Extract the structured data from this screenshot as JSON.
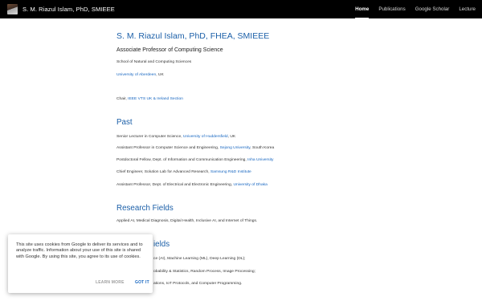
{
  "header": {
    "site_title": "S. M. Riazul Islam, PhD, SMIEEE",
    "nav": [
      {
        "label": "Home"
      },
      {
        "label": "Publications"
      },
      {
        "label": "Google Scholar"
      },
      {
        "label": "Lecture"
      }
    ]
  },
  "profile": {
    "name": "S. M. Riazul Islam, PhD, FHEA, SMIEEE",
    "role": "Associate Professor of Computing Science",
    "school": "School of Natural and Computing Sciences",
    "university_link": "University of Aberdeen",
    "university_suffix": ", UK",
    "chair_prefix": "Chair, ",
    "chair_link": "IEEE VTS UK & Ireland Section"
  },
  "past": {
    "heading": "Past",
    "items": [
      {
        "text": "Senior Lecturer in Computer Science, ",
        "link": "University of Huddersfield",
        "suffix": ", UK"
      },
      {
        "text": "Assistant Professor in Computer Science and Engineering, ",
        "link": "Sejong University",
        "suffix": ", South Korea"
      },
      {
        "text": "Postdoctoral Fellow, Dept. of Information and Communication Engineering, ",
        "link": "Inha University",
        "suffix": ""
      },
      {
        "text": "Chief Engineer, Solution Lab for Advanced Research, ",
        "link": "Samsung R&D Institute",
        "suffix": ""
      },
      {
        "text": "Assistant Professor, Dept. of Electrical and Electronic Engineering,  ",
        "link": "University of Dhaka",
        "suffix": ""
      }
    ]
  },
  "research": {
    "heading": "Research Fields",
    "text": "Applied AI, Medical Diagnosis, Digital Health, Inclusive AI, and Internet of Things."
  },
  "teaching": {
    "heading_fragment": "ields",
    "line1": "ce (AI), Machine Learning (ML), Deep Learning (DL);",
    "line2": "obability & Statistics, Random Process, Image Processing;",
    "line3": "ations, IoT Protocols, and Computer Programming."
  },
  "cookie": {
    "text": "This site uses cookies from Google to deliver its services and to analyze traffic. Information about your use of this site is shared with Google. By using this site, you agree to its use of cookies.",
    "learn_more": "LEARN MORE",
    "got_it": "GOT IT"
  }
}
